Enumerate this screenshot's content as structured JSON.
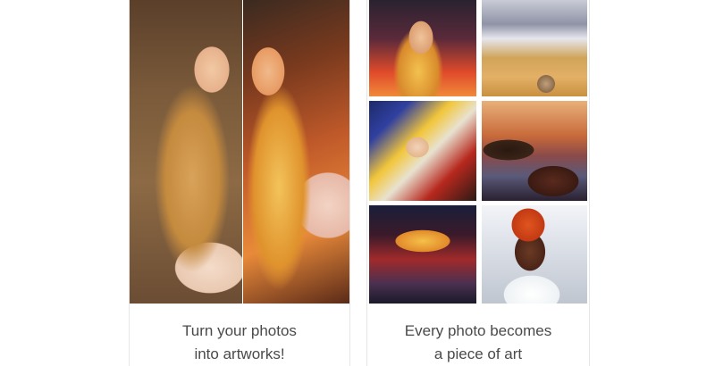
{
  "panels": [
    {
      "caption_line1": "Turn your photos",
      "caption_line2": "into artworks!"
    },
    {
      "caption_line1": "Every photo becomes",
      "caption_line2": "a piece of art"
    }
  ],
  "colors": {
    "caption_text": "#4a4a4a",
    "panel_border": "#e6e6e6",
    "background": "#ffffff"
  }
}
